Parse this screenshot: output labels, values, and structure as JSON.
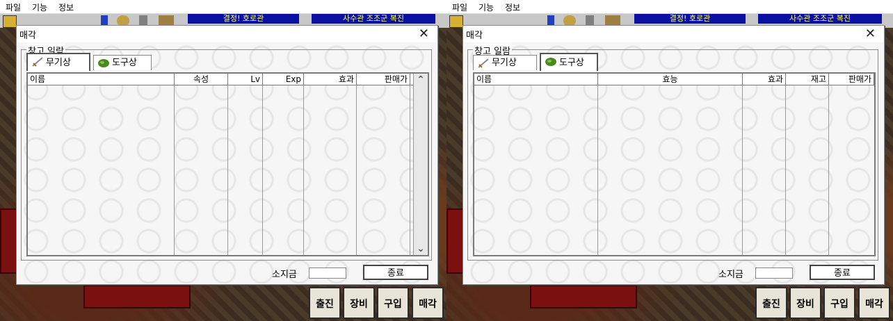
{
  "menu": {
    "file": "파일",
    "function": "기능",
    "info": "정보"
  },
  "topbar": {
    "left_box": "결정! 호로관",
    "right_box": "사수관 조조군 복진"
  },
  "screens": [
    {
      "dialog_title": "매각",
      "group_label": "창고 일람",
      "tabs": {
        "weapon": "무기상",
        "item": "도구상"
      },
      "active_tab": "weapon",
      "columns": [
        "이름",
        "속성",
        "Lv",
        "Exp",
        "효과",
        "판매가"
      ],
      "gold_label": "소지금",
      "gold_value": "",
      "close_button": "종료"
    },
    {
      "dialog_title": "매각",
      "group_label": "창고 일람",
      "tabs": {
        "weapon": "무기상",
        "item": "도구상"
      },
      "active_tab": "item",
      "columns": [
        "이름",
        "효능",
        "효과",
        "재고",
        "판매가"
      ],
      "gold_label": "소지금",
      "gold_value": "",
      "close_button": "종료"
    }
  ],
  "bottom_buttons": [
    "출진",
    "장비",
    "구입",
    "매각"
  ],
  "icons": {
    "weapon_tab": "sword-icon",
    "item_tab": "herb-icon",
    "close": "close-icon",
    "scroll_up": "chevron-up-icon",
    "scroll_down": "chevron-down-icon"
  }
}
